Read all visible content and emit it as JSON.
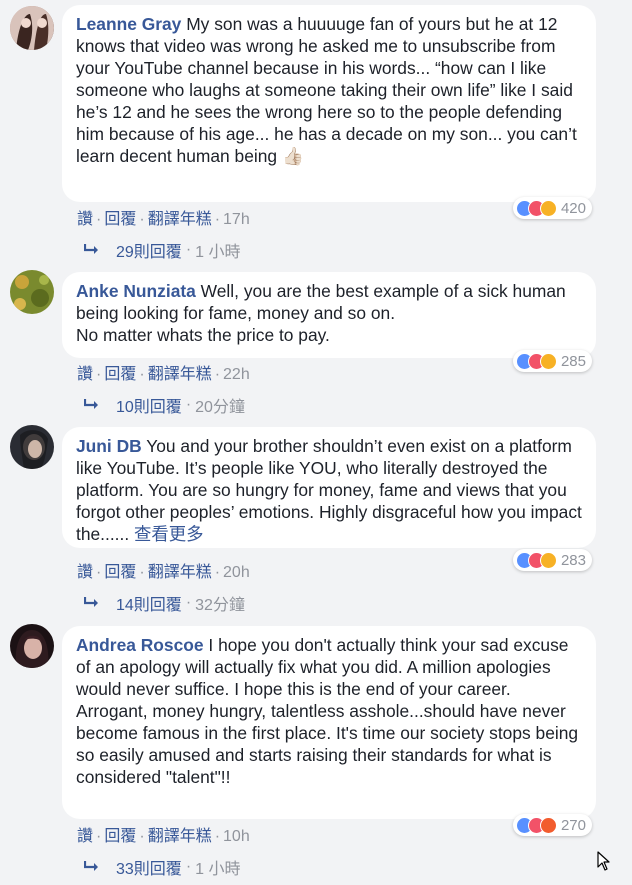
{
  "comments": [
    {
      "name": "Leanne Gray",
      "text": " My son was a huuuuge fan of yours but he at 12 knows that video was wrong he asked me to unsubscribe from your YouTube channel because in his words... “how can I like someone who laughs at someone taking their own life” like I said he’s 12 and he sees the wrong here so to the people defending him because of his age... he has a decade on my son... you can’t learn decent human being ",
      "emoji": "👍🏻",
      "actions": {
        "like": "讚",
        "reply": "回覆",
        "translate": "翻譯年糕",
        "time": "17h"
      },
      "reactions": {
        "icons": [
          "like-icon",
          "love-icon",
          "sad-icon"
        ],
        "count": "420"
      },
      "replies": {
        "count": "29則回覆",
        "time": "1 小時"
      }
    },
    {
      "name": "Anke Nunziata",
      "text": " Well, you are the best example of a sick human being looking for fame, money and so on.\nNo matter whats the price to pay.",
      "actions": {
        "like": "讚",
        "reply": "回覆",
        "translate": "翻譯年糕",
        "time": "22h"
      },
      "reactions": {
        "icons": [
          "like-icon",
          "love-icon",
          "haha-icon"
        ],
        "count": "285"
      },
      "replies": {
        "count": "10則回覆",
        "time": "20分鐘"
      }
    },
    {
      "name": "Juni DB",
      "text": " You and your brother shouldn’t even exist on a platform like YouTube. It’s people like YOU, who literally destroyed the platform. You are so hungry for money, fame and views that you forgot other peoples’ emotions. Highly disgraceful how you impact the...... ",
      "see_more": "查看更多",
      "actions": {
        "like": "讚",
        "reply": "回覆",
        "translate": "翻譯年糕",
        "time": "20h"
      },
      "reactions": {
        "icons": [
          "like-icon",
          "love-icon",
          "haha-icon"
        ],
        "count": "283"
      },
      "replies": {
        "count": "14則回覆",
        "time": "32分鐘"
      }
    },
    {
      "name": "Andrea Roscoe",
      "text": " I hope you don't actually think your sad excuse of an apology will actually fix what you did. A million apologies would never suffice. I hope this is the end of your career. Arrogant, money hungry, talentless asshole...should have never become famous in the first place. It's time our society stops being so easily amused and starts raising their standards for what is considered \"talent\"!!",
      "actions": {
        "like": "讚",
        "reply": "回覆",
        "translate": "翻譯年糕",
        "time": "10h"
      },
      "reactions": {
        "icons": [
          "like-icon",
          "love-icon",
          "angry-icon"
        ],
        "count": "270"
      },
      "replies": {
        "count": "33則回覆",
        "time": "1 小時"
      }
    }
  ],
  "separator": "·"
}
